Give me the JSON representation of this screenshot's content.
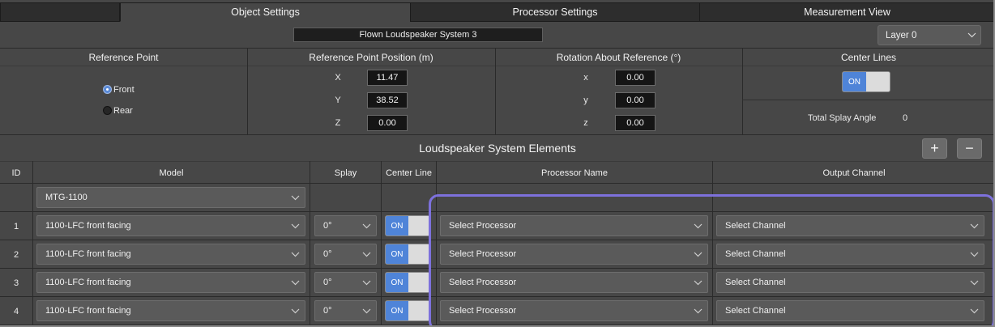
{
  "tabs": [
    {
      "label": "Object Settings",
      "active": true
    },
    {
      "label": "Processor Settings",
      "active": false
    },
    {
      "label": "Measurement View",
      "active": false
    }
  ],
  "system_name": "Flown Loudspeaker System 3",
  "layer": {
    "selected": "Layer 0"
  },
  "sections": {
    "reference_point": "Reference Point",
    "reference_position": "Reference Point Position (m)",
    "rotation": "Rotation About Reference (°)",
    "center_lines": "Center Lines"
  },
  "reference_point": {
    "options": [
      {
        "label": "Front",
        "selected": true
      },
      {
        "label": "Rear",
        "selected": false
      }
    ]
  },
  "position": {
    "x": {
      "label": "X",
      "value": "11.47"
    },
    "y": {
      "label": "Y",
      "value": "38.52"
    },
    "z": {
      "label": "Z",
      "value": "0.00"
    }
  },
  "rotation": {
    "x": {
      "label": "x",
      "value": "0.00"
    },
    "y": {
      "label": "y",
      "value": "0.00"
    },
    "z": {
      "label": "z",
      "value": "0.00"
    }
  },
  "center_lines": {
    "toggle": "ON",
    "total_splay_label": "Total Splay Angle",
    "total_splay_value": "0"
  },
  "elements_section": {
    "title": "Loudspeaker System Elements",
    "add_label": "+",
    "remove_label": "−"
  },
  "table": {
    "headers": {
      "id": "ID",
      "model": "Model",
      "splay": "Splay",
      "center_line": "Center Line",
      "processor": "Processor Name",
      "output": "Output Channel"
    },
    "master_model": "MTG-1100",
    "rows": [
      {
        "id": "1",
        "model": "1100-LFC front facing",
        "splay": "0°",
        "center": "ON",
        "processor": "Select Processor",
        "channel": "Select Channel"
      },
      {
        "id": "2",
        "model": "1100-LFC front facing",
        "splay": "0°",
        "center": "ON",
        "processor": "Select Processor",
        "channel": "Select Channel"
      },
      {
        "id": "3",
        "model": "1100-LFC front facing",
        "splay": "0°",
        "center": "ON",
        "processor": "Select Processor",
        "channel": "Select Channel"
      },
      {
        "id": "4",
        "model": "1100-LFC front facing",
        "splay": "0°",
        "center": "ON",
        "processor": "Select Processor",
        "channel": "Select Channel"
      }
    ]
  },
  "colors": {
    "accent": "#4f84d8",
    "highlight": "#7d71dc",
    "panel": "#474747"
  }
}
